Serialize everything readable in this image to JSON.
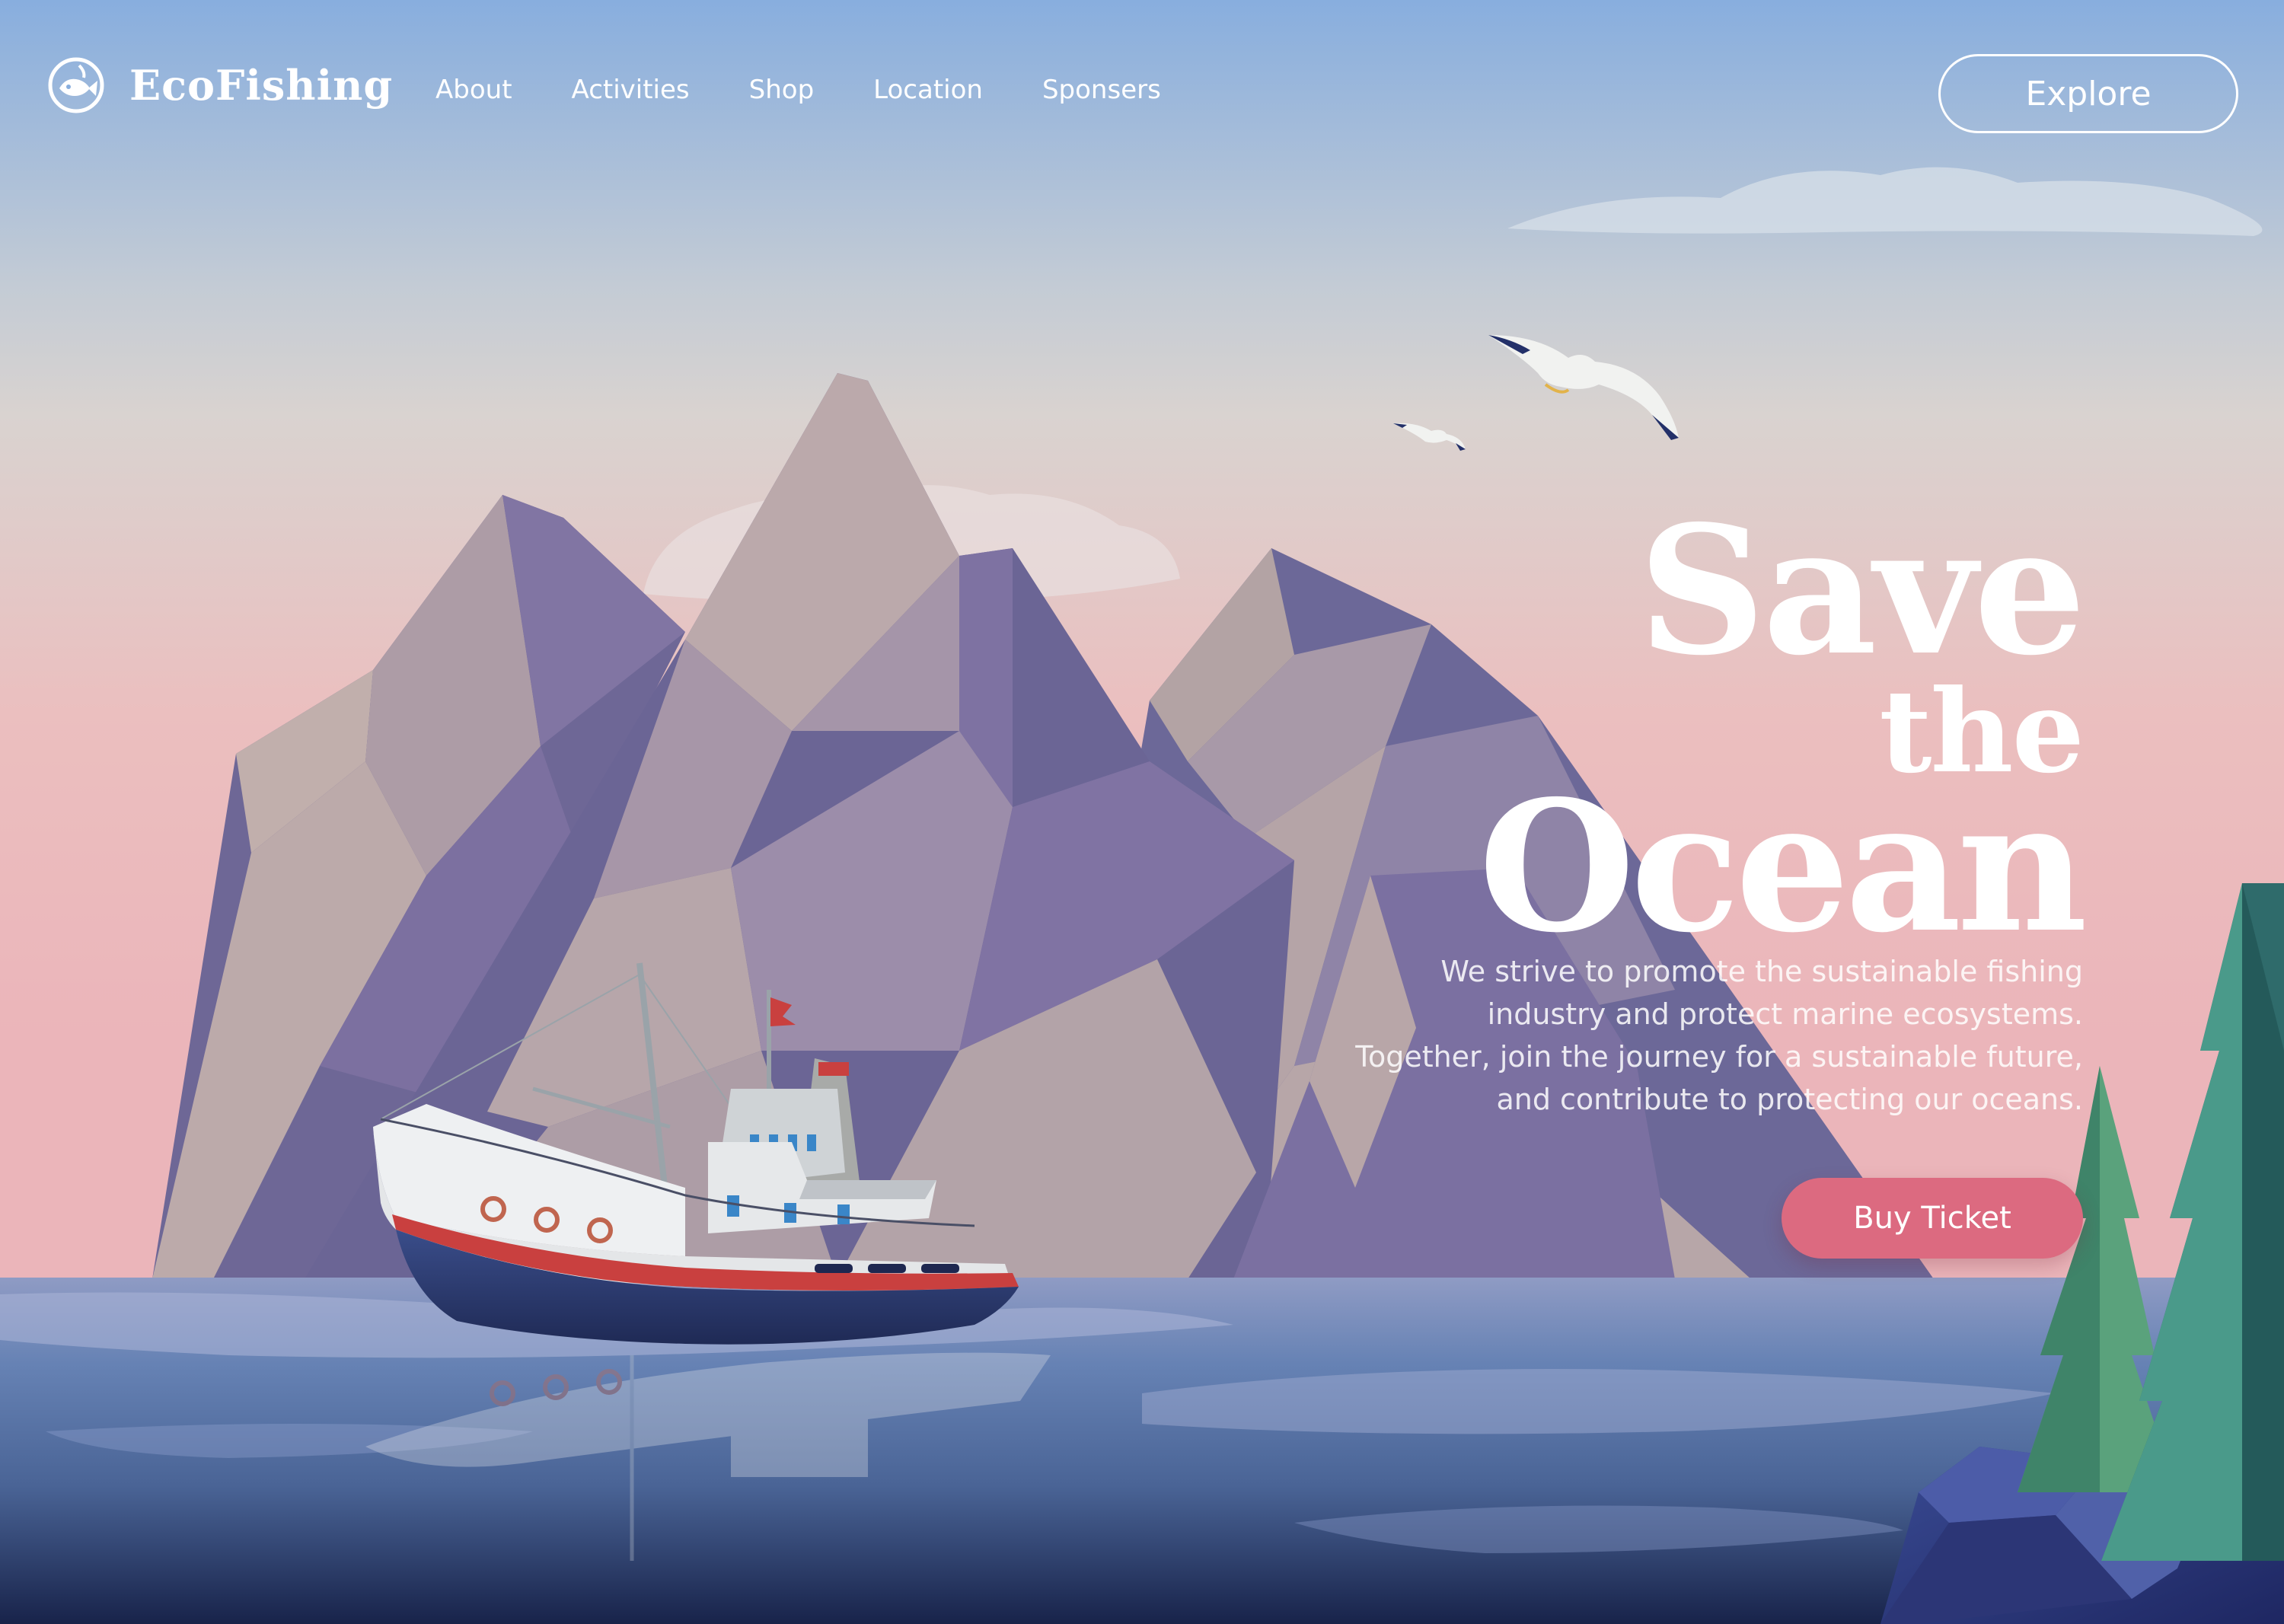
{
  "brand": {
    "name": "EcoFishing",
    "logo_icon": "fish-globe-icon"
  },
  "nav": {
    "links": [
      "About",
      "Activities",
      "Shop",
      "Location",
      "Sponsers"
    ],
    "cta_label": "Explore"
  },
  "hero": {
    "title_lines": [
      "Save",
      "the",
      "Ocean"
    ],
    "description_lines": [
      "We strive to promote the sustainable fishing",
      "industry and protect marine ecosystems.",
      "Together, join the journey for a sustainable future,",
      "and contribute to protecting our oceans."
    ],
    "button_label": "Buy Ticket"
  },
  "colors": {
    "sky_top": "#88aede",
    "sky_pink": "#ebb8bd",
    "mountain_purple": "#6e6796",
    "mountain_beige": "#b9a8a8",
    "sea": "#5a78a8",
    "sea_deep": "#1d2a52",
    "button_pink": "#dc6a80",
    "tree_green": "#2f6b6b"
  }
}
